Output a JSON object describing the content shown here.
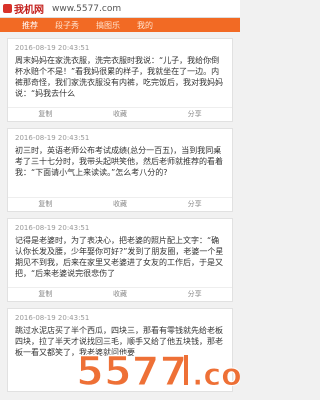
{
  "browser": {
    "site_name": "我机网",
    "url": "www.5577.com"
  },
  "tabs": [
    {
      "label": "推荐"
    },
    {
      "label": "段子秀"
    },
    {
      "label": "搞图乐"
    },
    {
      "label": "我的"
    }
  ],
  "actions": {
    "copy": "复制",
    "favorite": "收藏",
    "share": "分享"
  },
  "posts": [
    {
      "timestamp": "2016-08-19 20:43:51",
      "content": "周末妈妈在家洗衣服，洗完衣服时我说：“儿子，我给你倒杯水赔个不是！”看我妈很累的样子，我就坐在了一边。内裤那奇怪，我们家洗衣服没有内裤，吃完饭后，我对我妈妈说：“妈我去什么"
    },
    {
      "timestamp": "2016-08-19 20:43:51",
      "content": "初三时，英语老师公布考试成绩(总分一百五)，当到我同桌考了三十七分时，我带头起哄笑他，然后老师就推荐的看着我：“下面请小气上来读读。”怎么考八分的?"
    },
    {
      "timestamp": "2016-08-19 20:43:51",
      "content": "记得是老婆时，为了表决心，把老婆的照片配上文字：“确认你长发及腰，少年娶你可好?”发到了朋友圈，老婆一个星期见不到我，后来在家里又老婆进了女友的工作后，于是又把，“后来老婆说完很悲伤了"
    },
    {
      "timestamp": "2016-08-19 20:43:51",
      "content": "跳过水泥店买了半个西瓜，四块三，那看有零钱就先给老板四块，拉了半天才说找回三毛，顺手又给了他五块钱，那老板一看又都笑了，我老婆就问他要"
    }
  ]
}
